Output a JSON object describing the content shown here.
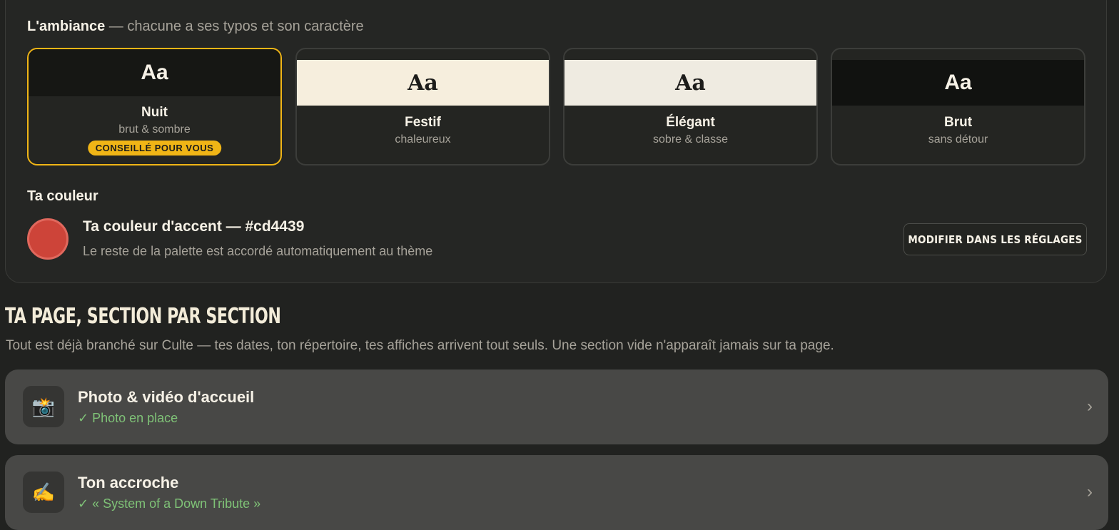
{
  "ambiance": {
    "title": "L'ambiance",
    "subtitle": " — chacune a ses typos et son caractère",
    "cards": [
      {
        "sample": "Aa",
        "name": "Nuit",
        "desc": "brut & sombre",
        "badge": "CONSEILLÉ POUR VOUS",
        "selected": true,
        "swatch_bg": "#161714",
        "swatch_fg": "#f6f1e6"
      },
      {
        "sample": "Aa",
        "name": "Festif",
        "desc": "chaleureux",
        "selected": false,
        "swatch_bg": "#f6eedd",
        "swatch_fg": "#1c1c1a"
      },
      {
        "sample": "Aa",
        "name": "Élégant",
        "desc": "sobre & classe",
        "selected": false,
        "swatch_bg": "#efebe1",
        "swatch_fg": "#1c1c1a"
      },
      {
        "sample": "Aa",
        "name": "Brut",
        "desc": "sans détour",
        "selected": false,
        "swatch_bg": "#111210",
        "swatch_fg": "#f6f1e6"
      }
    ]
  },
  "couleur": {
    "title": "Ta couleur",
    "accent_title": "Ta couleur d'accent — #cd4439",
    "accent_hex": "#cd4439",
    "accent_sub": "Le reste de la palette est accordé automatiquement au thème",
    "modify_button": "MODIFIER DANS LES RÉGLAGES"
  },
  "sections": {
    "heading": "TA PAGE, SECTION PAR SECTION",
    "description": "Tout est déjà branché sur Culte — tes dates, ton répertoire, tes affiches arrivent tout seuls. Une section vide n'apparaît jamais sur ta page.",
    "items": [
      {
        "icon": "camera-flash-icon",
        "glyph": "📸",
        "title": "Photo & vidéo d'accueil",
        "status": "✓ Photo en place"
      },
      {
        "icon": "writing-hand-icon",
        "glyph": "✍️",
        "title": "Ton accroche",
        "status": "✓ « System of a Down Tribute »"
      }
    ]
  },
  "colors": {
    "accent_yellow": "#f0b516",
    "status_green": "#7fc277",
    "background": "#212220"
  }
}
